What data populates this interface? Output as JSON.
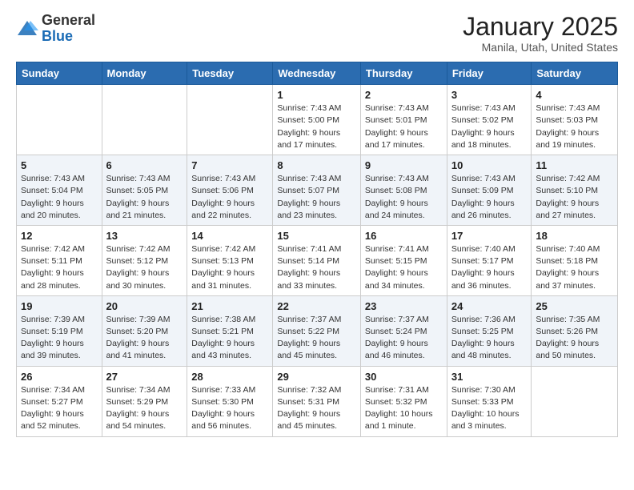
{
  "header": {
    "logo_general": "General",
    "logo_blue": "Blue",
    "title": "January 2025",
    "location": "Manila, Utah, United States"
  },
  "days_of_week": [
    "Sunday",
    "Monday",
    "Tuesday",
    "Wednesday",
    "Thursday",
    "Friday",
    "Saturday"
  ],
  "weeks": [
    [
      {
        "day": "",
        "info": ""
      },
      {
        "day": "",
        "info": ""
      },
      {
        "day": "",
        "info": ""
      },
      {
        "day": "1",
        "info": "Sunrise: 7:43 AM\nSunset: 5:00 PM\nDaylight: 9 hours\nand 17 minutes."
      },
      {
        "day": "2",
        "info": "Sunrise: 7:43 AM\nSunset: 5:01 PM\nDaylight: 9 hours\nand 17 minutes."
      },
      {
        "day": "3",
        "info": "Sunrise: 7:43 AM\nSunset: 5:02 PM\nDaylight: 9 hours\nand 18 minutes."
      },
      {
        "day": "4",
        "info": "Sunrise: 7:43 AM\nSunset: 5:03 PM\nDaylight: 9 hours\nand 19 minutes."
      }
    ],
    [
      {
        "day": "5",
        "info": "Sunrise: 7:43 AM\nSunset: 5:04 PM\nDaylight: 9 hours\nand 20 minutes."
      },
      {
        "day": "6",
        "info": "Sunrise: 7:43 AM\nSunset: 5:05 PM\nDaylight: 9 hours\nand 21 minutes."
      },
      {
        "day": "7",
        "info": "Sunrise: 7:43 AM\nSunset: 5:06 PM\nDaylight: 9 hours\nand 22 minutes."
      },
      {
        "day": "8",
        "info": "Sunrise: 7:43 AM\nSunset: 5:07 PM\nDaylight: 9 hours\nand 23 minutes."
      },
      {
        "day": "9",
        "info": "Sunrise: 7:43 AM\nSunset: 5:08 PM\nDaylight: 9 hours\nand 24 minutes."
      },
      {
        "day": "10",
        "info": "Sunrise: 7:43 AM\nSunset: 5:09 PM\nDaylight: 9 hours\nand 26 minutes."
      },
      {
        "day": "11",
        "info": "Sunrise: 7:42 AM\nSunset: 5:10 PM\nDaylight: 9 hours\nand 27 minutes."
      }
    ],
    [
      {
        "day": "12",
        "info": "Sunrise: 7:42 AM\nSunset: 5:11 PM\nDaylight: 9 hours\nand 28 minutes."
      },
      {
        "day": "13",
        "info": "Sunrise: 7:42 AM\nSunset: 5:12 PM\nDaylight: 9 hours\nand 30 minutes."
      },
      {
        "day": "14",
        "info": "Sunrise: 7:42 AM\nSunset: 5:13 PM\nDaylight: 9 hours\nand 31 minutes."
      },
      {
        "day": "15",
        "info": "Sunrise: 7:41 AM\nSunset: 5:14 PM\nDaylight: 9 hours\nand 33 minutes."
      },
      {
        "day": "16",
        "info": "Sunrise: 7:41 AM\nSunset: 5:15 PM\nDaylight: 9 hours\nand 34 minutes."
      },
      {
        "day": "17",
        "info": "Sunrise: 7:40 AM\nSunset: 5:17 PM\nDaylight: 9 hours\nand 36 minutes."
      },
      {
        "day": "18",
        "info": "Sunrise: 7:40 AM\nSunset: 5:18 PM\nDaylight: 9 hours\nand 37 minutes."
      }
    ],
    [
      {
        "day": "19",
        "info": "Sunrise: 7:39 AM\nSunset: 5:19 PM\nDaylight: 9 hours\nand 39 minutes."
      },
      {
        "day": "20",
        "info": "Sunrise: 7:39 AM\nSunset: 5:20 PM\nDaylight: 9 hours\nand 41 minutes."
      },
      {
        "day": "21",
        "info": "Sunrise: 7:38 AM\nSunset: 5:21 PM\nDaylight: 9 hours\nand 43 minutes."
      },
      {
        "day": "22",
        "info": "Sunrise: 7:37 AM\nSunset: 5:22 PM\nDaylight: 9 hours\nand 45 minutes."
      },
      {
        "day": "23",
        "info": "Sunrise: 7:37 AM\nSunset: 5:24 PM\nDaylight: 9 hours\nand 46 minutes."
      },
      {
        "day": "24",
        "info": "Sunrise: 7:36 AM\nSunset: 5:25 PM\nDaylight: 9 hours\nand 48 minutes."
      },
      {
        "day": "25",
        "info": "Sunrise: 7:35 AM\nSunset: 5:26 PM\nDaylight: 9 hours\nand 50 minutes."
      }
    ],
    [
      {
        "day": "26",
        "info": "Sunrise: 7:34 AM\nSunset: 5:27 PM\nDaylight: 9 hours\nand 52 minutes."
      },
      {
        "day": "27",
        "info": "Sunrise: 7:34 AM\nSunset: 5:29 PM\nDaylight: 9 hours\nand 54 minutes."
      },
      {
        "day": "28",
        "info": "Sunrise: 7:33 AM\nSunset: 5:30 PM\nDaylight: 9 hours\nand 56 minutes."
      },
      {
        "day": "29",
        "info": "Sunrise: 7:32 AM\nSunset: 5:31 PM\nDaylight: 9 hours\nand 45 minutes."
      },
      {
        "day": "30",
        "info": "Sunrise: 7:31 AM\nSunset: 5:32 PM\nDaylight: 10 hours\nand 1 minute."
      },
      {
        "day": "31",
        "info": "Sunrise: 7:30 AM\nSunset: 5:33 PM\nDaylight: 10 hours\nand 3 minutes."
      },
      {
        "day": "",
        "info": ""
      }
    ]
  ]
}
